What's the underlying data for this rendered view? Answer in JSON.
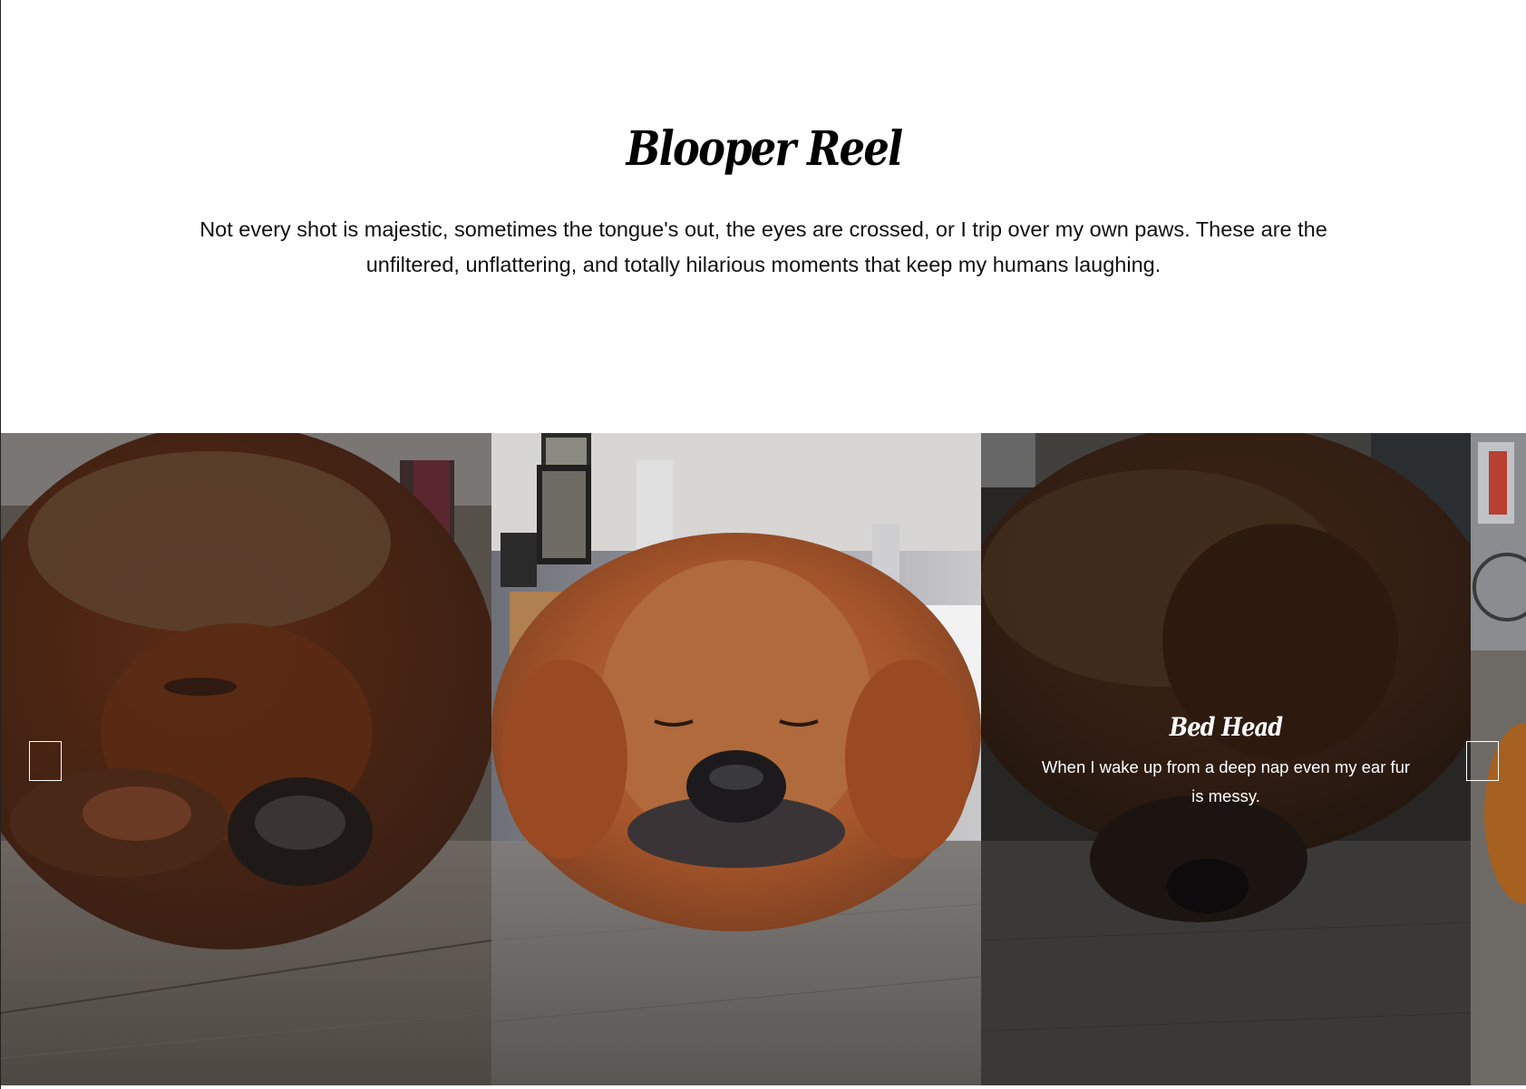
{
  "section": {
    "title": "Blooper Reel",
    "description": "Not every shot is majestic, sometimes the tongue's out, the eyes are crossed, or I trip over my own paws. These are the unfiltered, unflattering, and totally hilarious moments that keep my humans laughing."
  },
  "carousel": {
    "slides": [
      {
        "image": "sleeping-dog-paw-over-face"
      },
      {
        "image": "sleeping-dog-chin-on-floor"
      },
      {
        "image": "sleeping-dog-bed-head",
        "caption_title": "Bed Head",
        "caption_text": "When I wake up from a deep nap even my ear fur is messy."
      },
      {
        "image": "dog-partial-next-slide"
      }
    ],
    "prev_icon": "chevron-left-icon",
    "next_icon": "chevron-right-icon"
  },
  "colors": {
    "background": "#ffffff",
    "text": "#111111",
    "caption_text": "#ffffff",
    "overlay": "rgba(0,0,0,0.52)"
  }
}
